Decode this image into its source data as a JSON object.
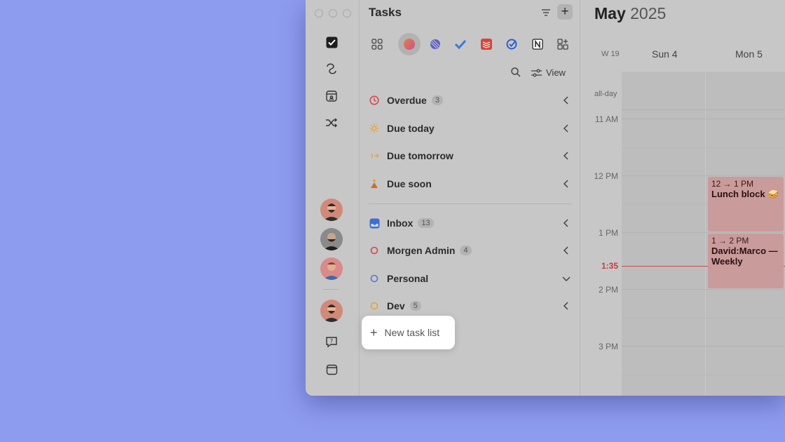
{
  "tasks": {
    "title": "Tasks",
    "view_label": "View",
    "new_list_label": "New task list",
    "smart_lists": [
      {
        "label": "Overdue",
        "count": "3"
      },
      {
        "label": "Due today",
        "count": ""
      },
      {
        "label": "Due tomorrow",
        "count": ""
      },
      {
        "label": "Due soon",
        "count": ""
      }
    ],
    "lists": [
      {
        "label": "Inbox",
        "count": "13"
      },
      {
        "label": "Morgen Admin",
        "count": "4"
      },
      {
        "label": "Personal",
        "count": ""
      },
      {
        "label": "Dev",
        "count": "5"
      }
    ]
  },
  "calendar": {
    "month": "May",
    "year": "2025",
    "week": "W 19",
    "days": [
      "Sun 4",
      "Mon 5"
    ],
    "allday_label": "all-day",
    "hours": [
      "11 AM",
      "12 PM",
      "1 PM",
      "2 PM",
      "3 PM"
    ],
    "now_label": "1:35",
    "events": [
      {
        "time": "12 → 1 PM",
        "name": "Lunch block 🥪"
      },
      {
        "time": "1 → 2 PM",
        "name": "David:Marco — Weekly"
      }
    ]
  },
  "colors": {
    "overdue": "#d24545",
    "today": "#e3a33a",
    "inbox": "#3e6fcf",
    "morgen": "#d24545",
    "personal": "#6a6fd0",
    "dev": "#e3a33a",
    "now": "#c63b3b"
  }
}
